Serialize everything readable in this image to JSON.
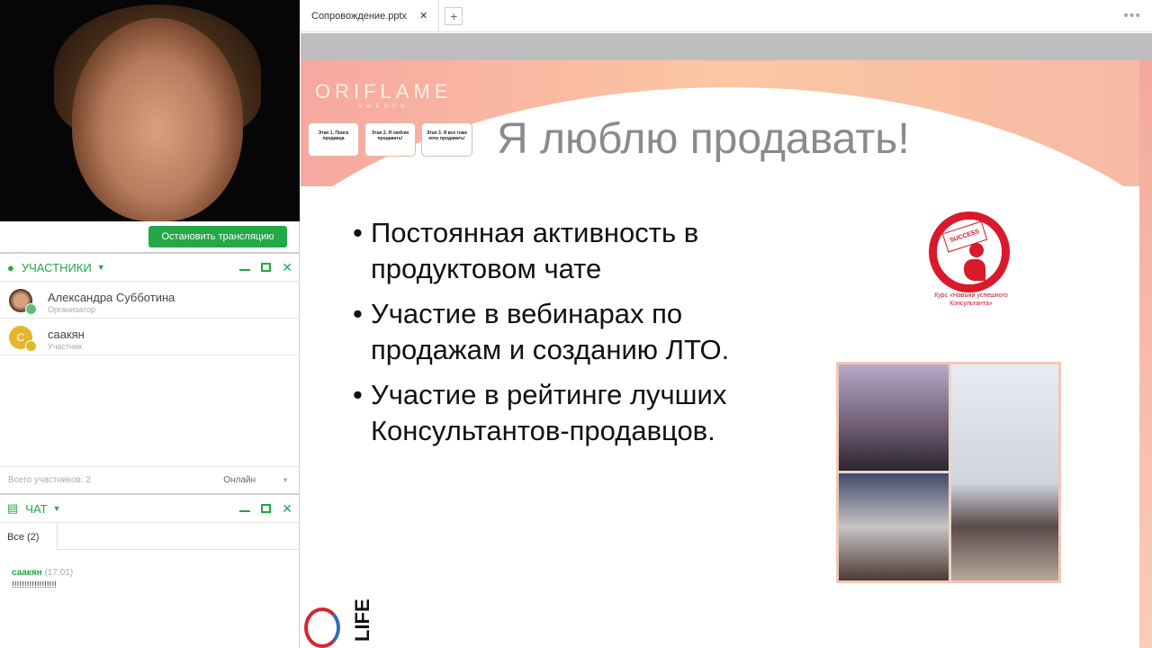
{
  "left": {
    "stop_button": "Остановить трансляцию",
    "participants": {
      "title": "УЧАСТНИКИ",
      "users": [
        {
          "name": "Александра Субботина",
          "role": "Организатор"
        },
        {
          "name": "саакян",
          "role": "Участник",
          "initial": "С"
        }
      ],
      "total": "Всего участников: 2",
      "filter": "Онлайн"
    },
    "chat": {
      "title": "ЧАТ",
      "tab": "Все (2)",
      "messages": [
        {
          "author": "саакян",
          "time": "(17:01)",
          "text": "!!!!!!!!!!!!!!!!!!"
        }
      ]
    }
  },
  "file_tab": {
    "name": "Сопровождение.pptx",
    "close": "✕",
    "add": "+",
    "more": "•••"
  },
  "slide": {
    "brand": "ORIFLAME",
    "brand_sub": "SWEDEN",
    "stages": [
      "Этап 1. Поиск продавца",
      "Этап 2. Я люблю продавать!",
      "Этап 3. Я все тоже хочу продавать!"
    ],
    "title": "Я люблю продавать!",
    "bullets": [
      "Постоянная активность в продуктовом чате",
      "Участие в вебинарах по продажам и созданию ЛТО.",
      "Участие в рейтинге лучших Консультантов-продавцов."
    ],
    "course_badge": "SUCCESS",
    "course_caption": "Курс «Навыки успешного Консультанта»",
    "corner_logo": "LIFE"
  },
  "colors": {
    "accent": "#22a845",
    "slide_red": "#d91a2a"
  }
}
